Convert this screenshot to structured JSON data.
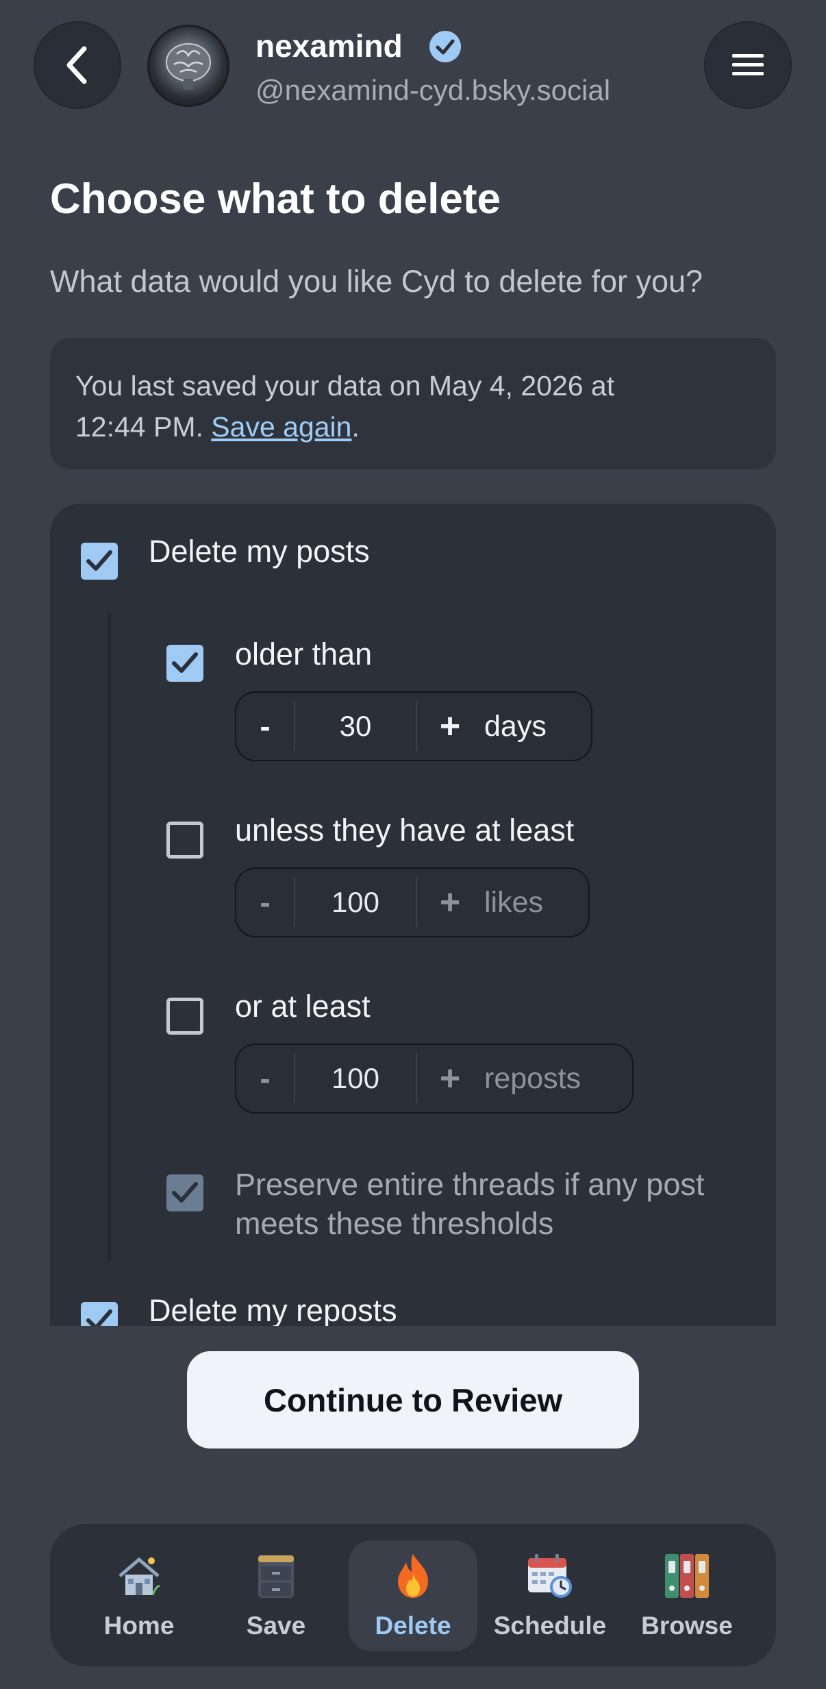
{
  "header": {
    "display_name": "nexamind",
    "handle": "@nexamind-cyd.bsky.social",
    "back_icon": "chevron-left-icon",
    "menu_icon": "hamburger-menu-icon",
    "verified_icon": "verified-badge-icon"
  },
  "page": {
    "title": "Choose what to delete",
    "subtitle": "What data would you like Cyd to delete for you?"
  },
  "notice": {
    "text_line1": "You last saved your data on May 4, 2026 at",
    "text_line2": "12:44 PM.",
    "link": "Save again",
    "trailing": "."
  },
  "options": {
    "delete_posts": {
      "label": "Delete my posts",
      "checked": true
    },
    "older_than": {
      "label": "older than",
      "checked": true,
      "minus": "-",
      "value": "30",
      "plus": "+",
      "unit": "days"
    },
    "min_likes": {
      "label": "unless they have at least",
      "checked": false,
      "minus": "-",
      "value": "100",
      "plus": "+",
      "unit": "likes"
    },
    "min_reposts": {
      "label": "or at least",
      "checked": false,
      "minus": "-",
      "value": "100",
      "plus": "+",
      "unit": "reposts"
    },
    "preserve_threads": {
      "label_line1": "Preserve entire threads if any post",
      "label_line2": "meets these thresholds",
      "checked": true,
      "disabled": true
    },
    "delete_reposts": {
      "label": "Delete my reposts",
      "checked": true
    }
  },
  "actions": {
    "continue": "Continue to Review"
  },
  "nav": {
    "items": [
      {
        "label": "Home",
        "icon": "house-icon",
        "active": false
      },
      {
        "label": "Save",
        "icon": "filing-cabinet-icon",
        "active": false
      },
      {
        "label": "Delete",
        "icon": "fire-icon",
        "active": true
      },
      {
        "label": "Schedule",
        "icon": "calendar-clock-icon",
        "active": false
      },
      {
        "label": "Browse",
        "icon": "binders-icon",
        "active": false
      }
    ]
  },
  "colors": {
    "background": "#3a3f4a",
    "panel": "#2c3039",
    "accent": "#9fcaf4",
    "link": "#9fccf5"
  }
}
